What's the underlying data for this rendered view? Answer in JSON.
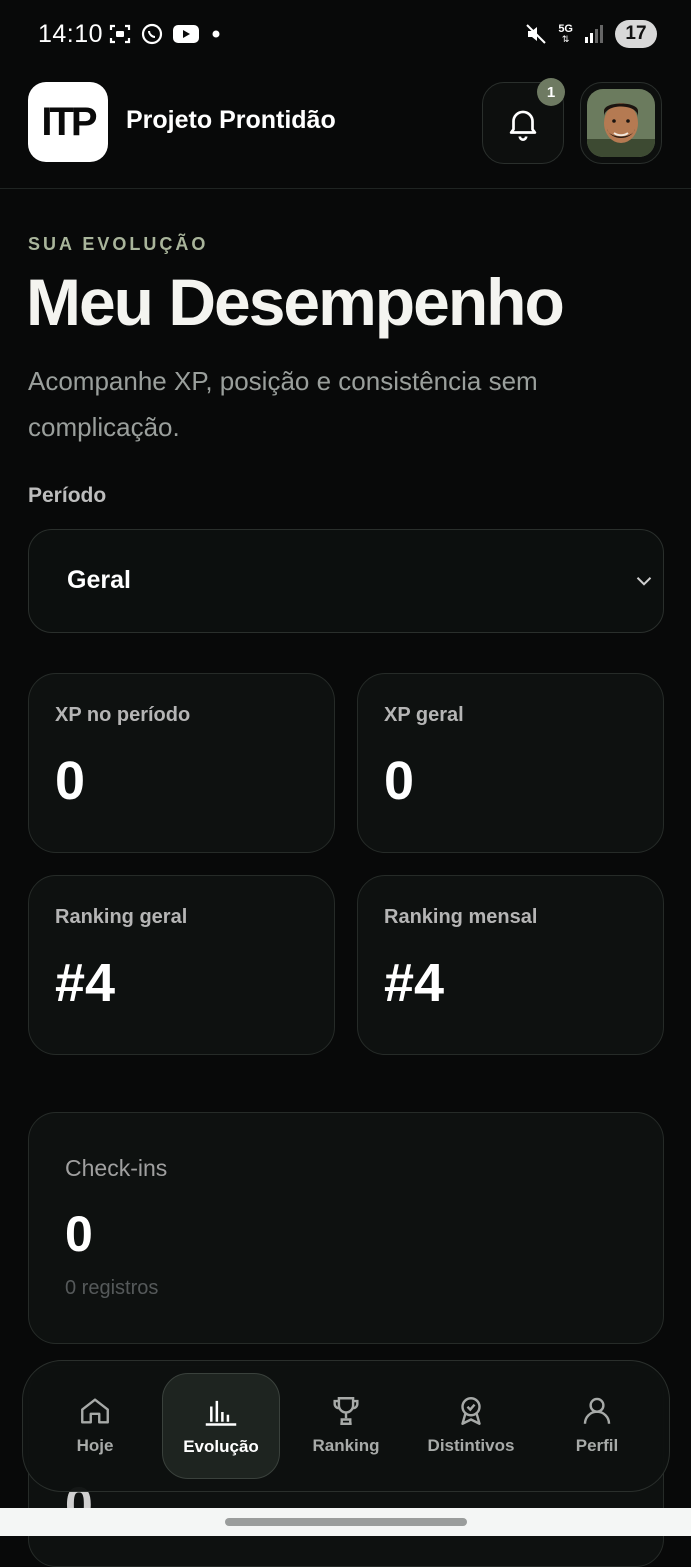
{
  "status": {
    "time": "14:10",
    "network": "5G",
    "battery": "17",
    "left_icons": [
      "screenshot-icon",
      "whatsapp-icon",
      "youtube-icon",
      "dot-icon"
    ],
    "right_icons": [
      "mute-icon",
      "network-5g-icon",
      "signal-icon",
      "battery-icon"
    ]
  },
  "header": {
    "logo_text": "ITP",
    "app_title": "Projeto Prontidão",
    "notification_count": "1"
  },
  "hero": {
    "eyebrow": "SUA EVOLUÇÃO",
    "title": "Meu Desempenho",
    "subtitle": "Acompanhe XP, posição e consistência sem complicação."
  },
  "period": {
    "label": "Período",
    "selected": "Geral"
  },
  "stats": [
    {
      "label": "XP no período",
      "value": "0"
    },
    {
      "label": "XP geral",
      "value": "0"
    },
    {
      "label": "Ranking geral",
      "value": "#4"
    },
    {
      "label": "Ranking mensal",
      "value": "#4"
    }
  ],
  "checkins": {
    "label": "Check-ins",
    "value": "0",
    "sub": "0 registros"
  },
  "next_card_value": "0",
  "nav": [
    {
      "label": "Hoje",
      "icon": "home-icon",
      "active": false
    },
    {
      "label": "Evolução",
      "icon": "chart-icon",
      "active": true
    },
    {
      "label": "Ranking",
      "icon": "trophy-icon",
      "active": false
    },
    {
      "label": "Distintivos",
      "icon": "badge-icon",
      "active": false
    },
    {
      "label": "Perfil",
      "icon": "user-icon",
      "active": false
    }
  ],
  "colors": {
    "background": "#080909",
    "accent_eyebrow": "#a9b59b",
    "badge": "#6e7a62",
    "card": "#0e1110"
  }
}
